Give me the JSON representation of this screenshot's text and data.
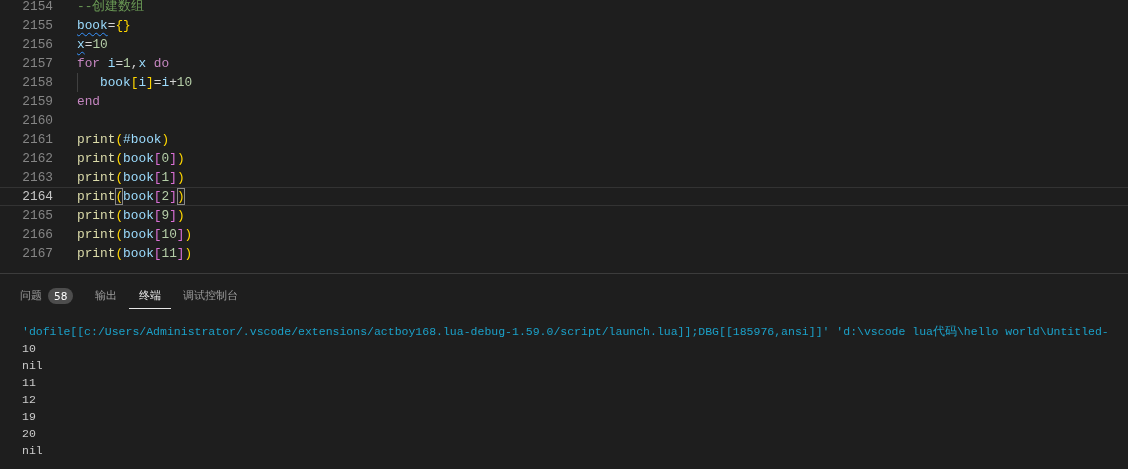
{
  "editor": {
    "lines": [
      {
        "number": "2154",
        "current": false,
        "indent": false,
        "tokens": [
          {
            "text": "--创建数组",
            "kind": "comment"
          }
        ]
      },
      {
        "number": "2155",
        "current": false,
        "indent": false,
        "tokens": [
          {
            "text": "book",
            "kind": "var",
            "squiggly": true
          },
          {
            "text": "=",
            "kind": "op"
          },
          {
            "text": "{}",
            "kind": "b1"
          }
        ]
      },
      {
        "number": "2156",
        "current": false,
        "indent": false,
        "tokens": [
          {
            "text": "x",
            "kind": "var",
            "squiggly": true
          },
          {
            "text": "=",
            "kind": "op"
          },
          {
            "text": "10",
            "kind": "num"
          }
        ]
      },
      {
        "number": "2157",
        "current": false,
        "indent": false,
        "tokens": [
          {
            "text": "for",
            "kind": "kw"
          },
          {
            "text": " i",
            "kind": "var"
          },
          {
            "text": "=",
            "kind": "op"
          },
          {
            "text": "1",
            "kind": "num"
          },
          {
            "text": ",",
            "kind": "op"
          },
          {
            "text": "x",
            "kind": "var"
          },
          {
            "text": " do",
            "kind": "kw"
          }
        ]
      },
      {
        "number": "2158",
        "current": false,
        "indent": true,
        "tokens": [
          {
            "text": "book",
            "kind": "var"
          },
          {
            "text": "[",
            "kind": "b1"
          },
          {
            "text": "i",
            "kind": "var"
          },
          {
            "text": "]",
            "kind": "b1"
          },
          {
            "text": "=",
            "kind": "op"
          },
          {
            "text": "i",
            "kind": "var"
          },
          {
            "text": "+",
            "kind": "op"
          },
          {
            "text": "10",
            "kind": "num"
          }
        ]
      },
      {
        "number": "2159",
        "current": false,
        "indent": false,
        "tokens": [
          {
            "text": "end",
            "kind": "kw"
          }
        ]
      },
      {
        "number": "2160",
        "current": false,
        "indent": false
      },
      {
        "number": "2161",
        "current": false,
        "indent": false,
        "tokens": [
          {
            "text": "print",
            "kind": "fn"
          },
          {
            "text": "(",
            "kind": "b1"
          },
          {
            "text": "#book",
            "kind": "var"
          },
          {
            "text": ")",
            "kind": "b1"
          }
        ]
      },
      {
        "number": "2162",
        "current": false,
        "indent": false,
        "tokens": [
          {
            "text": "print",
            "kind": "fn"
          },
          {
            "text": "(",
            "kind": "b1"
          },
          {
            "text": "book",
            "kind": "var"
          },
          {
            "text": "[",
            "kind": "b2"
          },
          {
            "text": "0",
            "kind": "num"
          },
          {
            "text": "]",
            "kind": "b2"
          },
          {
            "text": ")",
            "kind": "b1"
          }
        ]
      },
      {
        "number": "2163",
        "current": false,
        "indent": false,
        "tokens": [
          {
            "text": "print",
            "kind": "fn"
          },
          {
            "text": "(",
            "kind": "b1"
          },
          {
            "text": "book",
            "kind": "var"
          },
          {
            "text": "[",
            "kind": "b2"
          },
          {
            "text": "1",
            "kind": "num"
          },
          {
            "text": "]",
            "kind": "b2"
          },
          {
            "text": ")",
            "kind": "b1"
          }
        ]
      },
      {
        "number": "2164",
        "current": true,
        "indent": false,
        "tokens": [
          {
            "text": "print",
            "kind": "fn"
          },
          {
            "text": "(",
            "kind": "b1",
            "matched": true
          },
          {
            "text": "book",
            "kind": "var"
          },
          {
            "text": "[",
            "kind": "b2"
          },
          {
            "text": "2",
            "kind": "num"
          },
          {
            "text": "]",
            "kind": "b2"
          },
          {
            "text": ")",
            "kind": "b1",
            "matched": true
          }
        ]
      },
      {
        "number": "2165",
        "current": false,
        "indent": false,
        "tokens": [
          {
            "text": "print",
            "kind": "fn"
          },
          {
            "text": "(",
            "kind": "b1"
          },
          {
            "text": "book",
            "kind": "var"
          },
          {
            "text": "[",
            "kind": "b2"
          },
          {
            "text": "9",
            "kind": "num"
          },
          {
            "text": "]",
            "kind": "b2"
          },
          {
            "text": ")",
            "kind": "b1"
          }
        ]
      },
      {
        "number": "2166",
        "current": false,
        "indent": false,
        "tokens": [
          {
            "text": "print",
            "kind": "fn"
          },
          {
            "text": "(",
            "kind": "b1"
          },
          {
            "text": "book",
            "kind": "var"
          },
          {
            "text": "[",
            "kind": "b2"
          },
          {
            "text": "10",
            "kind": "num"
          },
          {
            "text": "]",
            "kind": "b2"
          },
          {
            "text": ")",
            "kind": "b1"
          }
        ]
      },
      {
        "number": "2167",
        "current": false,
        "indent": false,
        "tokens": [
          {
            "text": "print",
            "kind": "fn"
          },
          {
            "text": "(",
            "kind": "b1"
          },
          {
            "text": "book",
            "kind": "var"
          },
          {
            "text": "[",
            "kind": "b2"
          },
          {
            "text": "11",
            "kind": "num"
          },
          {
            "text": "]",
            "kind": "b2"
          },
          {
            "text": ")",
            "kind": "b1"
          }
        ]
      }
    ]
  },
  "panel": {
    "tabs": [
      {
        "label": "问题",
        "badge": "58",
        "selected": false
      },
      {
        "label": "输出",
        "selected": false
      },
      {
        "label": "终端",
        "selected": true
      },
      {
        "label": "调试控制台",
        "selected": false
      }
    ],
    "terminal": {
      "lines": [
        {
          "text": "'dofile[[c:/Users/Administrator/.vscode/extensions/actboy168.lua-debug-1.59.0/script/launch.lua]];DBG[[185976,ansi]]' 'd:\\vscode lua代码\\hello world\\Untitled-",
          "kind": "command"
        },
        {
          "text": "10",
          "kind": "output"
        },
        {
          "text": "nil",
          "kind": "output"
        },
        {
          "text": "11",
          "kind": "output"
        },
        {
          "text": "12",
          "kind": "output"
        },
        {
          "text": "19",
          "kind": "output"
        },
        {
          "text": "20",
          "kind": "output"
        },
        {
          "text": "nil",
          "kind": "output"
        }
      ]
    }
  }
}
